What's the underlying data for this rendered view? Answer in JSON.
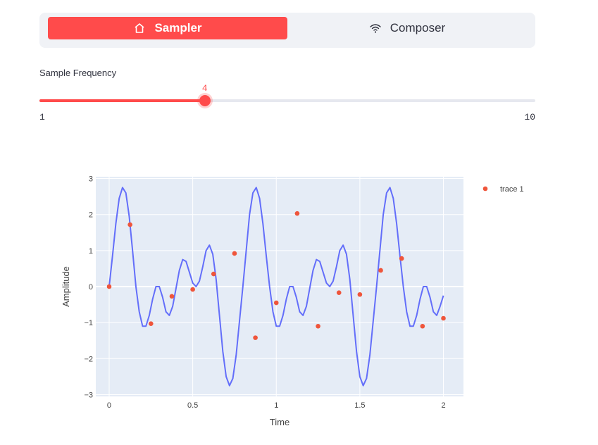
{
  "tabs": {
    "sampler_label": "Sampler",
    "composer_label": "Composer",
    "sampler_icon": "home-icon",
    "composer_icon": "wifi-icon"
  },
  "slider": {
    "label": "Sample Frequency",
    "value": "4",
    "min": "1",
    "max": "10",
    "fraction": 0.3333
  },
  "colors": {
    "accent": "#ff4b4b",
    "line": "#636efa",
    "marker": "#ef553b",
    "plot_bg": "#e5ecf6"
  },
  "chart_data": {
    "type": "scatter",
    "xlabel": "Time",
    "ylabel": "Amplitude",
    "xlim": [
      -0.08,
      2.12
    ],
    "ylim": [
      -3.05,
      3.05
    ],
    "x_ticks": [
      0,
      0.5,
      1,
      1.5,
      2
    ],
    "x_tick_labels": [
      "0",
      "0.5",
      "1",
      "1.5",
      "2"
    ],
    "y_ticks": [
      -3,
      -2,
      -1,
      0,
      1,
      2,
      3
    ],
    "y_tick_labels": [
      "−3",
      "−2",
      "−1",
      "0",
      "1",
      "2",
      "3"
    ],
    "legend_position": "top-right",
    "series": [
      {
        "mode": "line",
        "x": [
          0,
          0.02,
          0.04,
          0.06,
          0.08,
          0.1,
          0.12,
          0.14,
          0.16,
          0.18,
          0.2,
          0.22,
          0.24,
          0.26,
          0.28,
          0.3,
          0.32,
          0.34,
          0.36,
          0.38,
          0.4,
          0.42,
          0.44,
          0.46,
          0.48,
          0.5,
          0.52,
          0.54,
          0.56,
          0.58,
          0.6,
          0.62,
          0.64,
          0.66,
          0.68,
          0.7,
          0.72,
          0.74,
          0.76,
          0.78,
          0.8,
          0.82,
          0.84,
          0.86,
          0.88,
          0.9,
          0.92,
          0.94,
          0.96,
          0.98,
          1.0,
          1.02,
          1.04,
          1.06,
          1.08,
          1.1,
          1.12,
          1.14,
          1.16,
          1.18,
          1.2,
          1.22,
          1.24,
          1.26,
          1.28,
          1.3,
          1.32,
          1.34,
          1.36,
          1.38,
          1.4,
          1.42,
          1.44,
          1.46,
          1.48,
          1.5,
          1.52,
          1.54,
          1.56,
          1.58,
          1.6,
          1.62,
          1.64,
          1.66,
          1.68,
          1.7,
          1.72,
          1.74,
          1.76,
          1.78,
          1.8,
          1.82,
          1.84,
          1.86,
          1.88,
          1.9,
          1.92,
          1.94,
          1.96,
          1.98,
          2.0
        ],
        "y": [
          0,
          0.85,
          1.75,
          2.45,
          2.75,
          2.6,
          1.95,
          1.0,
          0.0,
          -0.7,
          -1.1,
          -1.1,
          -0.8,
          -0.35,
          0.0,
          0.0,
          -0.3,
          -0.7,
          -0.8,
          -0.55,
          -0.05,
          0.45,
          0.75,
          0.7,
          0.4,
          0.1,
          0.0,
          0.15,
          0.55,
          1.0,
          1.15,
          0.9,
          0.2,
          -0.8,
          -1.8,
          -2.5,
          -2.75,
          -2.55,
          -1.9,
          -0.95,
          0.0,
          1.0,
          2.0,
          2.6,
          2.75,
          2.45,
          1.75,
          0.85,
          0.0,
          -0.7,
          -1.1,
          -1.1,
          -0.8,
          -0.35,
          0.0,
          0.0,
          -0.3,
          -0.7,
          -0.8,
          -0.55,
          -0.05,
          0.45,
          0.75,
          0.7,
          0.4,
          0.1,
          0.0,
          0.15,
          0.55,
          1.0,
          1.15,
          0.9,
          0.2,
          -0.8,
          -1.8,
          -2.5,
          -2.75,
          -2.55,
          -1.9,
          -0.95,
          0.0,
          1.0,
          2.0,
          2.6,
          2.75,
          2.45,
          1.75,
          0.85,
          0.0,
          -0.7,
          -1.1,
          -1.1,
          -0.8,
          -0.35,
          0.0,
          0.0,
          -0.3,
          -0.7,
          -0.8,
          -0.55,
          -0.25
        ]
      },
      {
        "name": "trace 1",
        "mode": "markers",
        "x": [
          0,
          0.125,
          0.25,
          0.375,
          0.5,
          0.625,
          0.75,
          0.875,
          1.0,
          1.125,
          1.25,
          1.375,
          1.5,
          1.625,
          1.75,
          1.875,
          2.0
        ],
        "y": [
          0,
          1.72,
          -1.03,
          -0.27,
          -0.08,
          0.35,
          0.92,
          -1.42,
          -0.45,
          2.03,
          -1.1,
          -0.17,
          -0.22,
          0.45,
          0.78,
          -1.1,
          -0.88
        ]
      }
    ]
  }
}
